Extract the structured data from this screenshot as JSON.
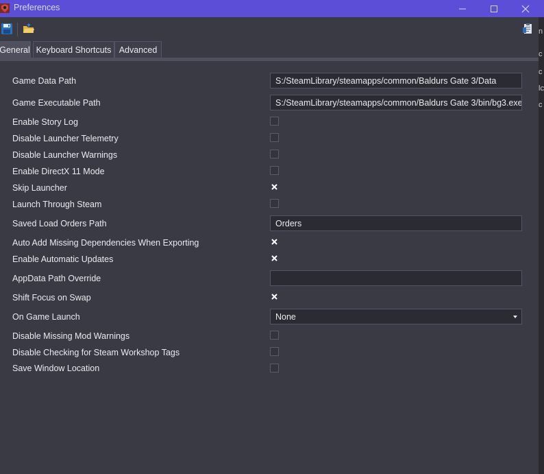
{
  "window": {
    "title": "Preferences",
    "minimize_label": "—",
    "maximize_label": "☐",
    "close_label": "✕"
  },
  "toolbar": {
    "save_icon": "save-icon",
    "open_icon": "open-folder-icon",
    "help_icon": "clipboard-icon"
  },
  "tabs": [
    {
      "label": "General",
      "active": true
    },
    {
      "label": "Keyboard Shortcuts",
      "active": false
    },
    {
      "label": "Advanced",
      "active": false
    }
  ],
  "settings": {
    "game_data_path": {
      "label": "Game Data Path",
      "value": "S:/SteamLibrary/steamapps/common/Baldurs Gate 3/Data"
    },
    "game_executable_path": {
      "label": "Game Executable Path",
      "value": "S:/SteamLibrary/steamapps/common/Baldurs Gate 3/bin/bg3.exe"
    },
    "enable_story_log": {
      "label": "Enable Story Log",
      "checked": false
    },
    "disable_launcher_telemetry": {
      "label": "Disable Launcher Telemetry",
      "checked": false
    },
    "disable_launcher_warnings": {
      "label": "Disable Launcher Warnings",
      "checked": false
    },
    "enable_directx11": {
      "label": "Enable DirectX 11 Mode",
      "checked": false
    },
    "skip_launcher": {
      "label": "Skip Launcher",
      "checked": true
    },
    "launch_through_steam": {
      "label": "Launch Through Steam",
      "checked": false
    },
    "saved_load_orders_path": {
      "label": "Saved Load Orders Path",
      "value": "Orders"
    },
    "auto_add_missing_deps": {
      "label": "Auto Add Missing Dependencies When Exporting",
      "checked": true
    },
    "enable_automatic_updates": {
      "label": "Enable Automatic Updates",
      "checked": true
    },
    "appdata_path_override": {
      "label": "AppData Path Override",
      "value": ""
    },
    "shift_focus_on_swap": {
      "label": "Shift Focus on Swap",
      "checked": true
    },
    "on_game_launch": {
      "label": "On Game Launch",
      "value": "None"
    },
    "disable_missing_mod_warnings": {
      "label": "Disable Missing Mod Warnings",
      "checked": false
    },
    "disable_checking_workshop_tags": {
      "label": "Disable Checking for Steam Workshop Tags",
      "checked": false
    },
    "save_window_location": {
      "label": "Save Window Location",
      "checked": false
    }
  },
  "colors": {
    "titlebar": "#5c4ed6",
    "background": "#3a3a45",
    "field_background": "#2b2b33"
  },
  "background_window_edge": [
    "n",
    "c",
    "c",
    "lc",
    "c"
  ]
}
